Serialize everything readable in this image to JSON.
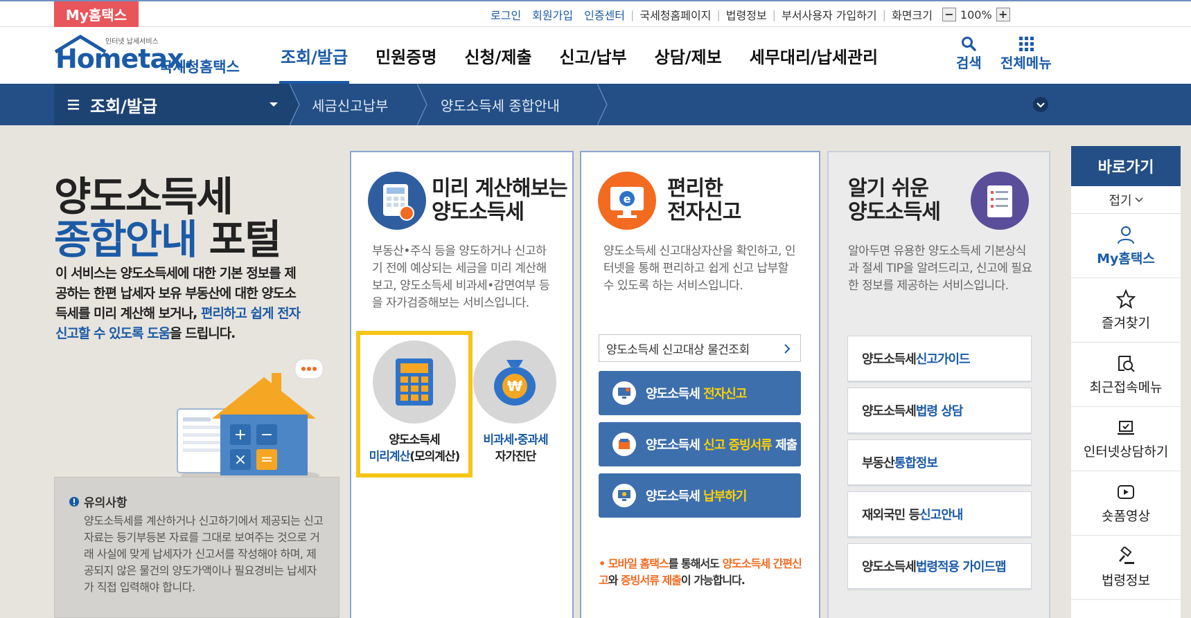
{
  "topbar": {
    "myhometax_tab": "My홈택스",
    "links": [
      "로그인",
      "회원가입",
      "인증센터",
      "국세청홈페이지",
      "법령정보",
      "부서사용자 가입하기",
      "화면크기"
    ],
    "zoom_minus": "−",
    "zoom_value": "100%",
    "zoom_plus": "+"
  },
  "header": {
    "logo_small": "인터넷 납세서비스",
    "logo_eng": "Hometax.",
    "logo_kor": "국세청홈택스",
    "nav": [
      "조회/발급",
      "민원증명",
      "신청/제출",
      "신고/납부",
      "상담/제보",
      "세무대리/납세관리"
    ],
    "search_label": "검색",
    "allmenu_label": "전체메뉴"
  },
  "breadcrumb": {
    "menu": "조회/발급",
    "items": [
      "세금신고납부",
      "양도소득세 종합안내"
    ]
  },
  "intro": {
    "title_line1": "양도소득세",
    "title_line2_blue": "종합안내",
    "title_line2_dark": " 포털",
    "desc_part1": "이 서비스는 양도소득세에 대한 기본 정보를 제공하는 한편 납세자 보유 부동산에 대한 양도소득세를 미리 계산해 보거나, ",
    "desc_highlight": "편리하고 쉽게 전자신고할 수 있도록 도움",
    "desc_part2": "을 드립니다.",
    "notice_title": "유의사항",
    "notice_body": "양도소득세를 계산하거나 신고하기에서 제공되는 신고 자료는 등기부등본 자료를 그대로 보여주는 것으로 거래 사실에 맞게 납세자가 신고서를 작성해야 하며, 제공되지 않은 물건의 양도가액이나 필요경비는 납세자가 직접 입력해야 합니다."
  },
  "panel1": {
    "title_line1": "미리 계산해보는",
    "title_line2": "양도소득세",
    "desc": "부동산•주식 등을 양도하거나 신고하기 전에 예상되는 세금을 미리 계산해보고, 양도소득세 비과세•감면여부 등을 자가검증해보는 서비스입니다.",
    "calc_label_line1": "양도소득세",
    "calc_label_line2_blue": "미리계산",
    "calc_label_line2_dark": "(모의계산)",
    "check_label_line1": "비과세·중과세",
    "check_label_line2": "자가진단"
  },
  "panel2": {
    "title_line1": "편리한",
    "title_line2": "전자신고",
    "desc": "양도소득세 신고대상자산을 확인하고, 인터넷을 통해 편리하고 쉽게 신고 납부할 수 있도록 하는 서비스입니다.",
    "lookup_label": "양도소득세 신고대상 물건조회",
    "btn1_a": "양도소득세 ",
    "btn1_b": "전자신고",
    "btn2_a": "양도소득세 ",
    "btn2_b": "신고 증빙서류",
    "btn2_c": " 제출",
    "btn3_a": "양도소득세 ",
    "btn3_b": "납부하기",
    "mobile_a": "• 모바일 홈택스",
    "mobile_b": "를 통해서도 ",
    "mobile_c": "양도소득세 간편신고",
    "mobile_d": "와 ",
    "mobile_e": "증빙서류 제출",
    "mobile_f": "이 가능합니다."
  },
  "panel3": {
    "title_line1": "알기 쉬운",
    "title_line2": "양도소득세",
    "desc": "알아두면 유용한 양도소득세 기본상식과 절세 TIP을 알려드리고, 신고에 필요한 정보를 제공하는 서비스입니다.",
    "guides": [
      {
        "a": "양도소득세 ",
        "b": "신고가이드"
      },
      {
        "a": "양도소득세 ",
        "b": "법령 상담"
      },
      {
        "a": "부동산 ",
        "b": "통합정보"
      },
      {
        "a": "재외국민 등 ",
        "b": "신고안내"
      },
      {
        "a": "양도소득세 ",
        "b": "법령적용 가이드맵"
      }
    ]
  },
  "quickbar": {
    "title": "바로가기",
    "fold": "접기",
    "items": [
      "My홈택스",
      "즐겨찾기",
      "최근접속메뉴",
      "인터넷상담하기",
      "숏폼영상",
      "법령정보"
    ]
  },
  "colors": {
    "brand_blue": "#1b5aa6",
    "nav_bar": "#234f86",
    "button_blue": "#3e6fad",
    "highlight_frame": "#f5c518",
    "my_tab_red": "#e8555a",
    "accent_orange": "#f26b21"
  }
}
